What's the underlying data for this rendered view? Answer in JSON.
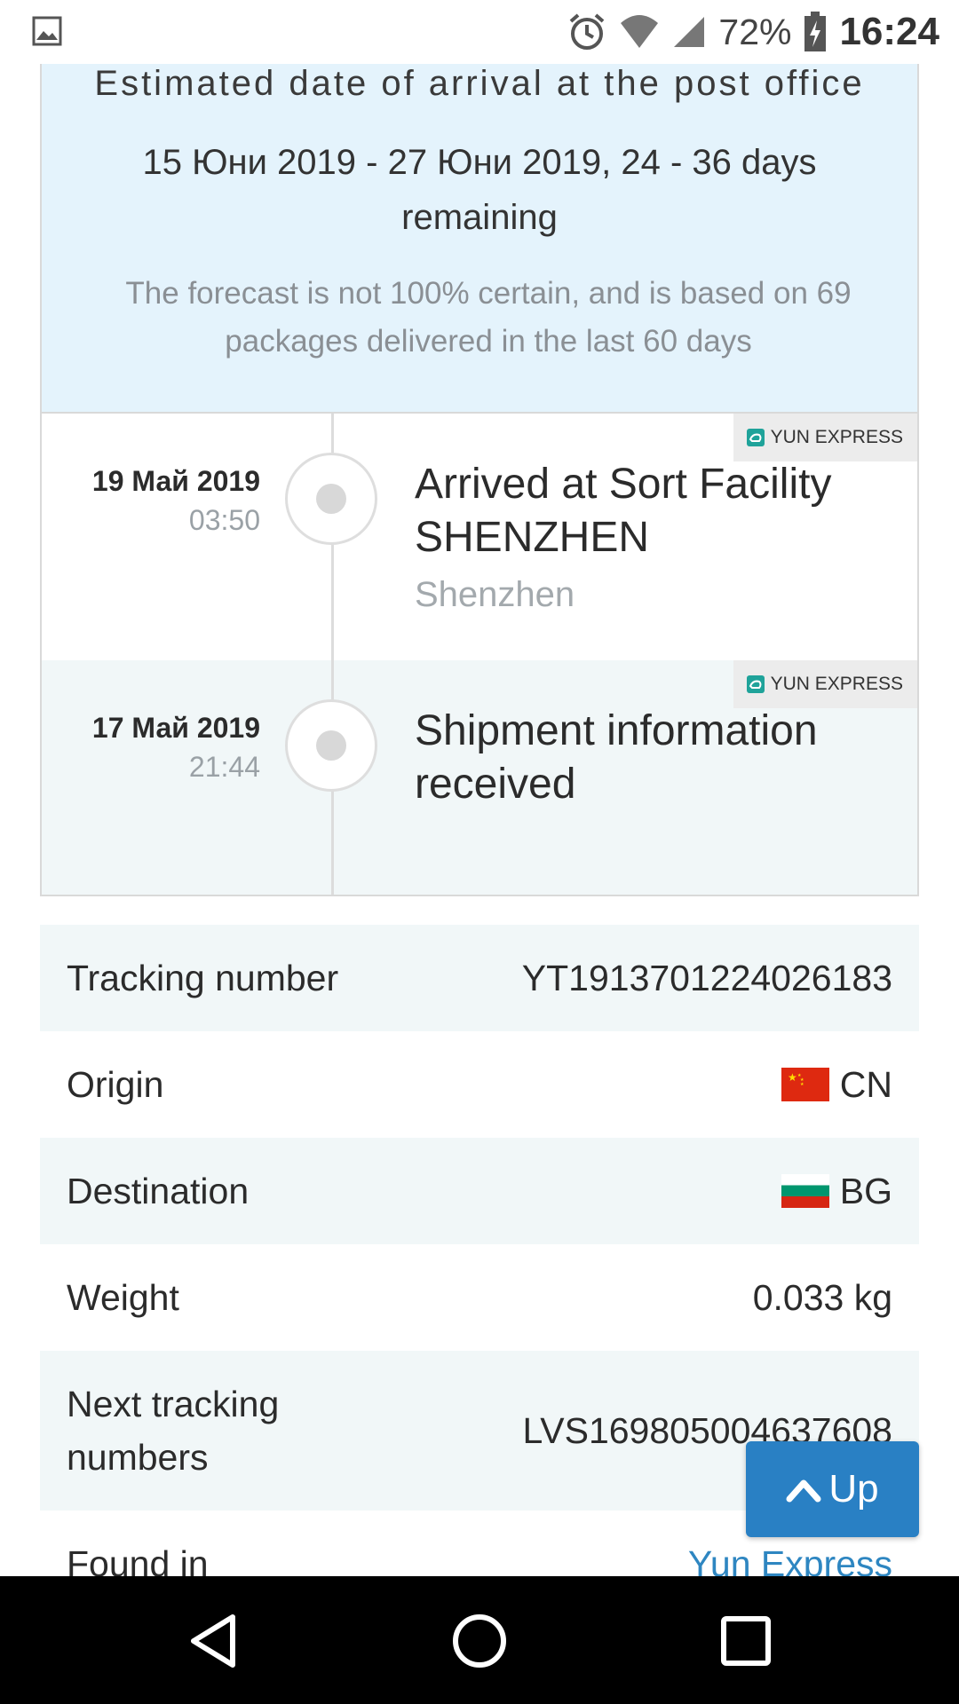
{
  "status_bar": {
    "battery": "72%",
    "time": "16:24",
    "icons": [
      "gallery-icon",
      "alarm-icon",
      "wifi-icon",
      "signal-icon",
      "battery-charging-icon"
    ]
  },
  "estimate": {
    "title": "Estimated date of arrival at the post office",
    "range": "15 Юни 2019 - 27 Юни 2019, 24 - 36 days remaining",
    "note": "The forecast is not 100% certain, and is based on 69 packages delivered in the last 60 days"
  },
  "events": [
    {
      "date": "19 Май 2019",
      "time": "03:50",
      "title": "Arrived at Sort Facility SHENZHEN",
      "location": "Shenzhen",
      "carrier": "YUN EXPRESS"
    },
    {
      "date": "17 Май 2019",
      "time": "21:44",
      "title": "Shipment information received",
      "location": "",
      "carrier": "YUN EXPRESS"
    }
  ],
  "details": {
    "tracking_number_label": "Tracking number",
    "tracking_number": "YT1913701224026183",
    "origin_label": "Origin",
    "origin": "CN",
    "destination_label": "Destination",
    "destination": "BG",
    "weight_label": "Weight",
    "weight": "0.033 kg",
    "next_tracking_label": "Next tracking numbers",
    "next_tracking": "LVS169805004637608",
    "found_in_label": "Found in",
    "found_in": "Yun Express"
  },
  "up_button": {
    "label": "Up",
    "icon": "chevron-up-icon"
  },
  "colors": {
    "estimate_bg": "#e4f3fc",
    "alt_row_bg": "#f1f7f8",
    "accent_blue": "#2980c4",
    "link_blue": "#2e86c1"
  }
}
